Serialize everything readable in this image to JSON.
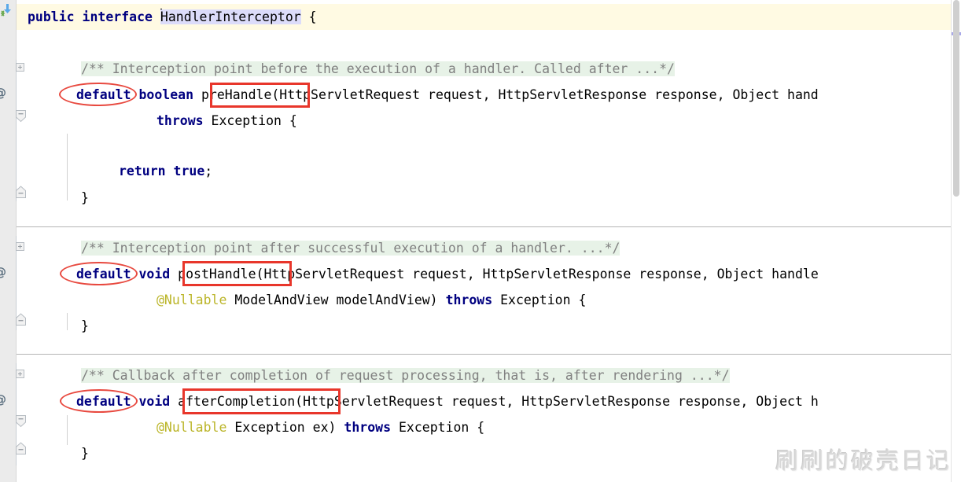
{
  "editor": {
    "language": "java",
    "theme": "IntelliJ Light",
    "colors": {
      "keyword": "#000080",
      "comment_text": "#808080",
      "comment_background": "#e7f2e7",
      "annotation": "#bbb529",
      "caret_row_background": "#fffae3",
      "identifier_highlight": "#dcdcfa",
      "gutter_background": "#ebebeb",
      "annotation_box": "#e8362b",
      "annotation_ellipse": "#e8493f",
      "marker_stripe": "#a9a9e8"
    },
    "lines": [
      {
        "id": "line-declaration",
        "segments": [
          {
            "text": "public",
            "style": "kw"
          },
          {
            "text": " ",
            "style": "plain"
          },
          {
            "text": "interface",
            "style": "kw"
          },
          {
            "text": " ",
            "style": "plain"
          },
          {
            "text": "HandlerInterceptor",
            "style": "ident-hl"
          },
          {
            "text": " {",
            "style": "plain"
          }
        ],
        "full_text": "public interface HandlerInterceptor {"
      },
      {
        "id": "line-prehandle-comment",
        "full_text": "/** Interception point before the execution of a handler. Called after ...*/"
      },
      {
        "id": "line-prehandle-signature",
        "full_text": "default boolean preHandle(HttpServletRequest request, HttpServletResponse response, Object hand"
      },
      {
        "id": "line-prehandle-throws",
        "full_text": "throws Exception {"
      },
      {
        "id": "line-prehandle-return",
        "full_text": "return true;"
      },
      {
        "id": "line-prehandle-close",
        "full_text": "}"
      },
      {
        "id": "line-posthandle-comment",
        "full_text": "/** Interception point after successful execution of a handler. ...*/"
      },
      {
        "id": "line-posthandle-signature",
        "full_text": "default void postHandle(HttpServletRequest request, HttpServletResponse response, Object handle"
      },
      {
        "id": "line-posthandle-params",
        "full_text": "@Nullable ModelAndView modelAndView) throws Exception {"
      },
      {
        "id": "line-posthandle-close",
        "full_text": "}"
      },
      {
        "id": "line-aftercompletion-comment",
        "full_text": "/** Callback after completion of request processing, that is, after rendering ...*/"
      },
      {
        "id": "line-aftercompletion-signature",
        "full_text": "default void afterCompletion(HttpServletRequest request, HttpServletResponse response, Object h"
      },
      {
        "id": "line-aftercompletion-params",
        "full_text": "@Nullable Exception ex) throws Exception {"
      },
      {
        "id": "line-aftercompletion-close",
        "full_text": "}"
      }
    ],
    "code": {
      "l1_public": "public",
      "l1_interface": "interface",
      "l1_name": "HandlerInterceptor",
      "l1_brace": " {",
      "l2_comment": "/** Interception point before the execution of a handler. Called after ...*/",
      "l3_default": "default",
      "l3_type": "boolean",
      "l3_rest": "preHandle(HttpServletRequest request, HttpServletResponse response, Object hand",
      "l4_throws": "throws",
      "l4_rest": " Exception {",
      "l5_return": "return",
      "l5_true": "true",
      "l5_semi": ";",
      "l6_close": "}",
      "l7_comment": "/** Interception point after successful execution of a handler. ...*/",
      "l8_default": "default",
      "l8_type": "void",
      "l8_rest": "postHandle(HttpServletRequest request, HttpServletResponse response, Object handle",
      "l9_anno": "@Nullable",
      "l9_mid": " ModelAndView modelAndView) ",
      "l9_throws": "throws",
      "l9_rest": " Exception {",
      "l10_close": "}",
      "l11_comment": "/** Callback after completion of request processing, that is, after rendering ...*/",
      "l12_default": "default",
      "l12_type": "void",
      "l12_rest": "afterCompletion(HttpServletRequest request, HttpServletResponse response, Object h",
      "l13_anno": "@Nullable",
      "l13_mid": " Exception ex) ",
      "l13_throws": "throws",
      "l13_rest": " Exception {",
      "l14_close": "}"
    },
    "highlighted_methods": [
      {
        "name": "preHandle",
        "label": "preHandle("
      },
      {
        "name": "postHandle",
        "label": "postHandle("
      },
      {
        "name": "afterCompletion",
        "label": "afterCompletion("
      }
    ],
    "circled_keywords": [
      {
        "label": "default"
      },
      {
        "label": "default"
      },
      {
        "label": "default"
      }
    ],
    "gutter": {
      "icons": [
        {
          "name": "implemented-method-icon",
          "type": "arrow"
        },
        {
          "name": "annotation-marker-icon",
          "type": "at"
        },
        {
          "name": "fold-expand-icon",
          "type": "plus"
        },
        {
          "name": "fold-collapse-icon",
          "type": "minus"
        }
      ]
    },
    "watermark": "刷刷的破壳日记"
  }
}
